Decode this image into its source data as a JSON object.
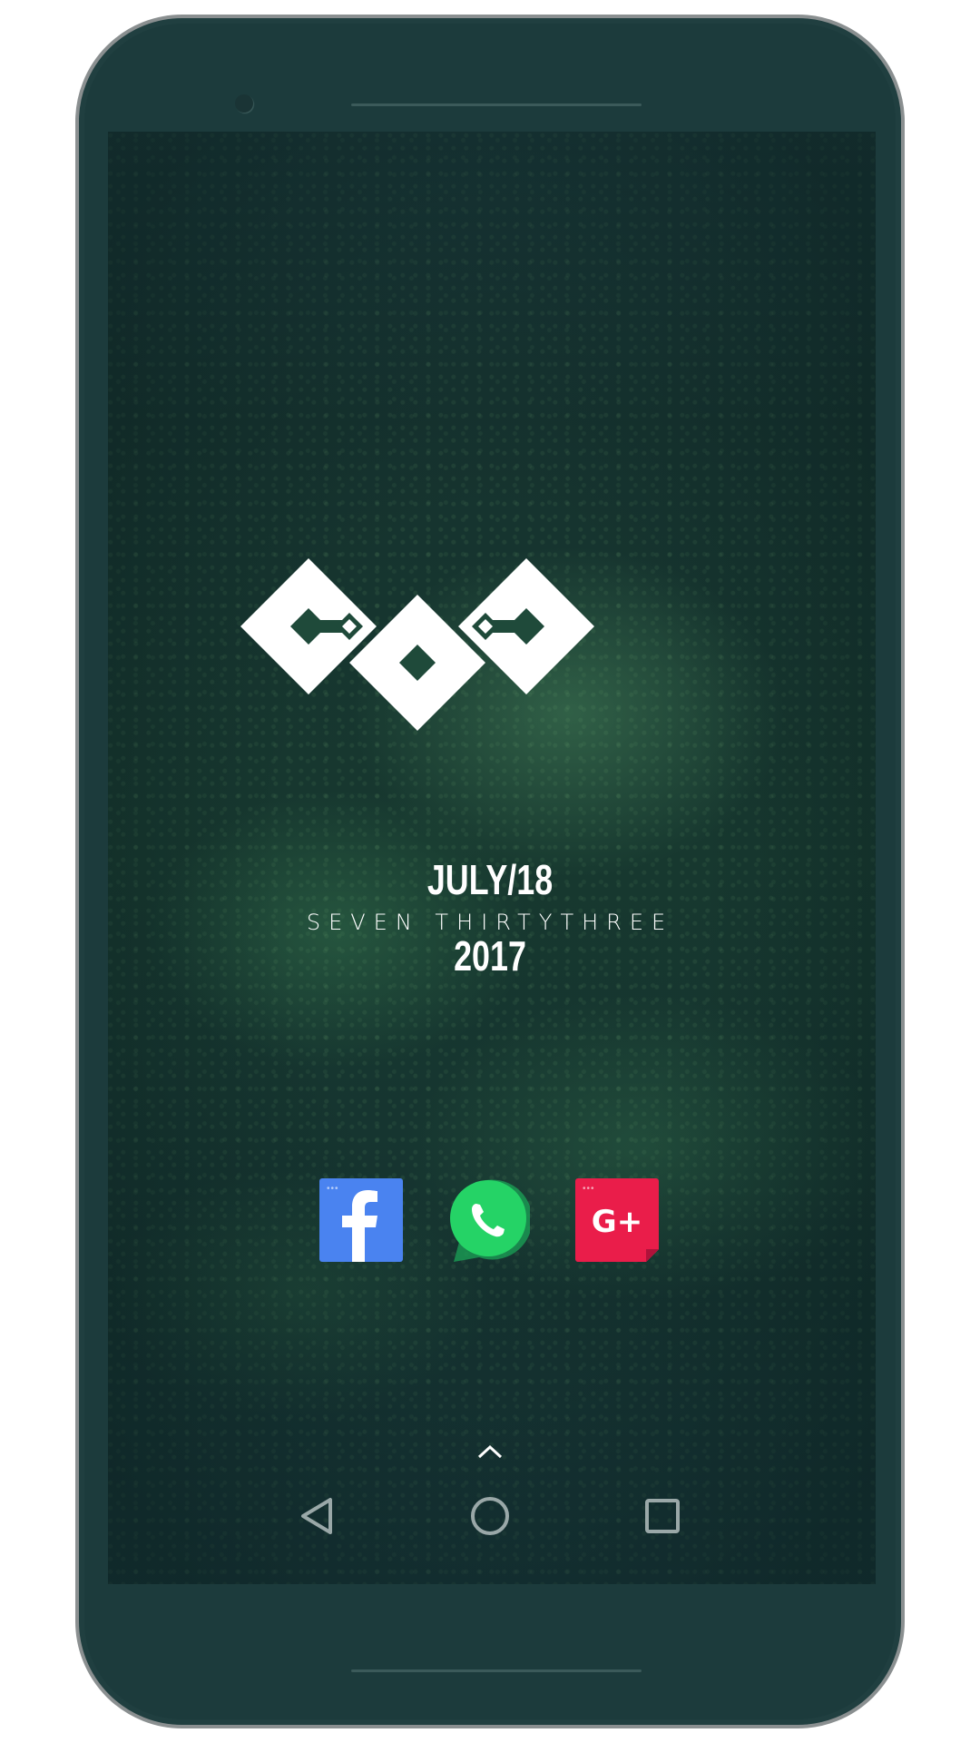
{
  "widget": {
    "date_line": "JULY/18",
    "time_line": "SEVEN THIRTYTHREE",
    "year_line": "2017"
  },
  "dock": {
    "apps": [
      {
        "name": "Facebook",
        "icon": "facebook-icon",
        "color": "#4a83f0",
        "glyph": "f"
      },
      {
        "name": "WhatsApp",
        "icon": "whatsapp-icon",
        "color": "#25d366"
      },
      {
        "name": "Google+",
        "icon": "google-plus-icon",
        "color": "#ea1d4a",
        "glyph": "G+"
      }
    ]
  },
  "navigation": {
    "buttons": [
      "back-icon",
      "home-icon",
      "recents-icon"
    ],
    "drawer_handle": "chevron-up-icon"
  },
  "colors": {
    "phone_body": "#1c3b3c",
    "frame_border": "#8a8f90",
    "widget_text": "#ffffff"
  }
}
